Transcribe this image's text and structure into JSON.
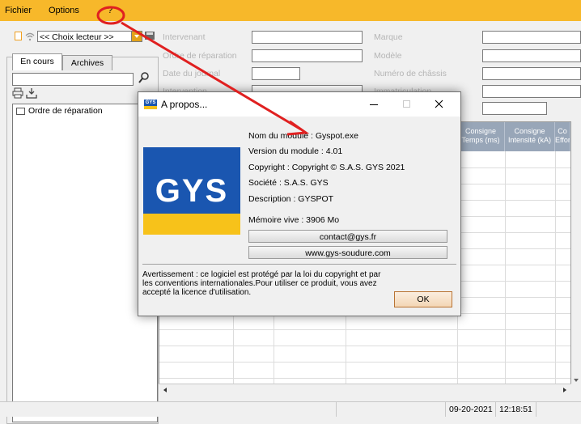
{
  "menubar": {
    "items": [
      "Fichier",
      "Options",
      "?"
    ]
  },
  "leftpanel": {
    "reader_combo": "<< Choix lecteur >>",
    "tabs": [
      "En cours",
      "Archives"
    ],
    "tree_item": "Ordre de réparation"
  },
  "form": {
    "left_labels": [
      "Intervenant",
      "Ordre de réparation",
      "Date du journal",
      "Intervention"
    ],
    "right_labels": [
      "Marque",
      "Modèle",
      "Numéro de châssis",
      "Immatriculation"
    ]
  },
  "grid": {
    "headers": [
      {
        "line1": "Consigne",
        "line2": "Temps (ms)"
      },
      {
        "line1": "Consigne",
        "line2": "Intensité (kA)"
      },
      {
        "line1": "Co",
        "line2": "Effor"
      }
    ]
  },
  "statusbar": {
    "date": "09-20-2021",
    "time": "12:18:51"
  },
  "dialog": {
    "title": "A propos...",
    "logo_text": "GYS",
    "title_icon_text": "GYS",
    "info_lines": [
      "Nom du module : Gyspot.exe",
      "Version du module : 4.01",
      "Copyright : Copyright © S.A.S. GYS 2021",
      "Société : S.A.S. GYS",
      "Description : GYSPOT"
    ],
    "memory": "Mémoire vive : 3906 Mo",
    "contact_button": "contact@gys.fr",
    "website_button": "www.gys-soudure.com",
    "warning": "Avertissement : ce logiciel est protégé par la loi du copyright et par les conventions internationales.Pour utiliser ce produit, vous avez accepté la licence d'utilisation.",
    "ok_button": "OK"
  },
  "colors": {
    "menubar": "#f7b82a",
    "annotation": "#e02020",
    "logo_blue": "#1a56b0",
    "logo_yellow": "#f7c21a"
  }
}
